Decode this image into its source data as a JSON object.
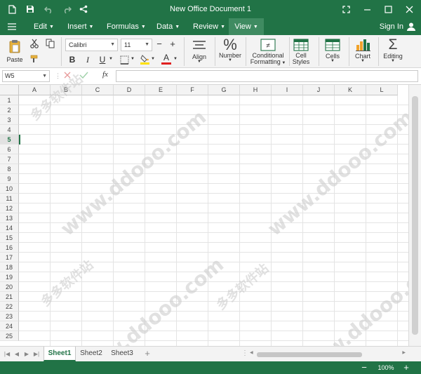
{
  "app": {
    "title": "New Office Document 1"
  },
  "menu": {
    "items": [
      {
        "label": "Edit"
      },
      {
        "label": "Insert"
      },
      {
        "label": "Formulas"
      },
      {
        "label": "Data"
      },
      {
        "label": "Review"
      },
      {
        "label": "View"
      }
    ],
    "active": "View",
    "sign_in": "Sign In"
  },
  "ribbon": {
    "paste": "Paste",
    "font_name": "Calibri",
    "font_size": "11",
    "bold": "B",
    "italic": "I",
    "underline": "U",
    "font_color_glyph": "A",
    "align": "Align",
    "number": "Number",
    "number_glyph": "%",
    "conditional_1": "Conditional",
    "conditional_2": "Formatting",
    "cell_styles_1": "Cell",
    "cell_styles_2": "Styles",
    "cells": "Cells",
    "chart": "Chart",
    "editing": "Editing",
    "editing_glyph": "Σ"
  },
  "formula_bar": {
    "name_box": "W5",
    "fx": "fx",
    "value": ""
  },
  "grid": {
    "columns": [
      "A",
      "B",
      "C",
      "D",
      "E",
      "F",
      "G",
      "H",
      "I",
      "J",
      "K",
      "L"
    ],
    "rows": [
      "1",
      "2",
      "3",
      "4",
      "5",
      "6",
      "7",
      "8",
      "9",
      "10",
      "11",
      "12",
      "13",
      "14",
      "15",
      "16",
      "17",
      "18",
      "19",
      "20",
      "21",
      "22",
      "23",
      "24",
      "25"
    ],
    "selected_row": "5"
  },
  "sheets": {
    "tabs": [
      "Sheet1",
      "Sheet2",
      "Sheet3"
    ],
    "active": "Sheet1",
    "add": "+"
  },
  "status": {
    "zoom": "100%",
    "minus": "−",
    "plus": "+"
  },
  "watermark": {
    "text_1": "www.ddooo.com",
    "text_2": "多多软件站"
  },
  "colors": {
    "accent": "#217346",
    "active_menu": "#3f8b61",
    "ribbon_bg": "#f3f3f3",
    "chart_bar": "#f0a22a"
  }
}
